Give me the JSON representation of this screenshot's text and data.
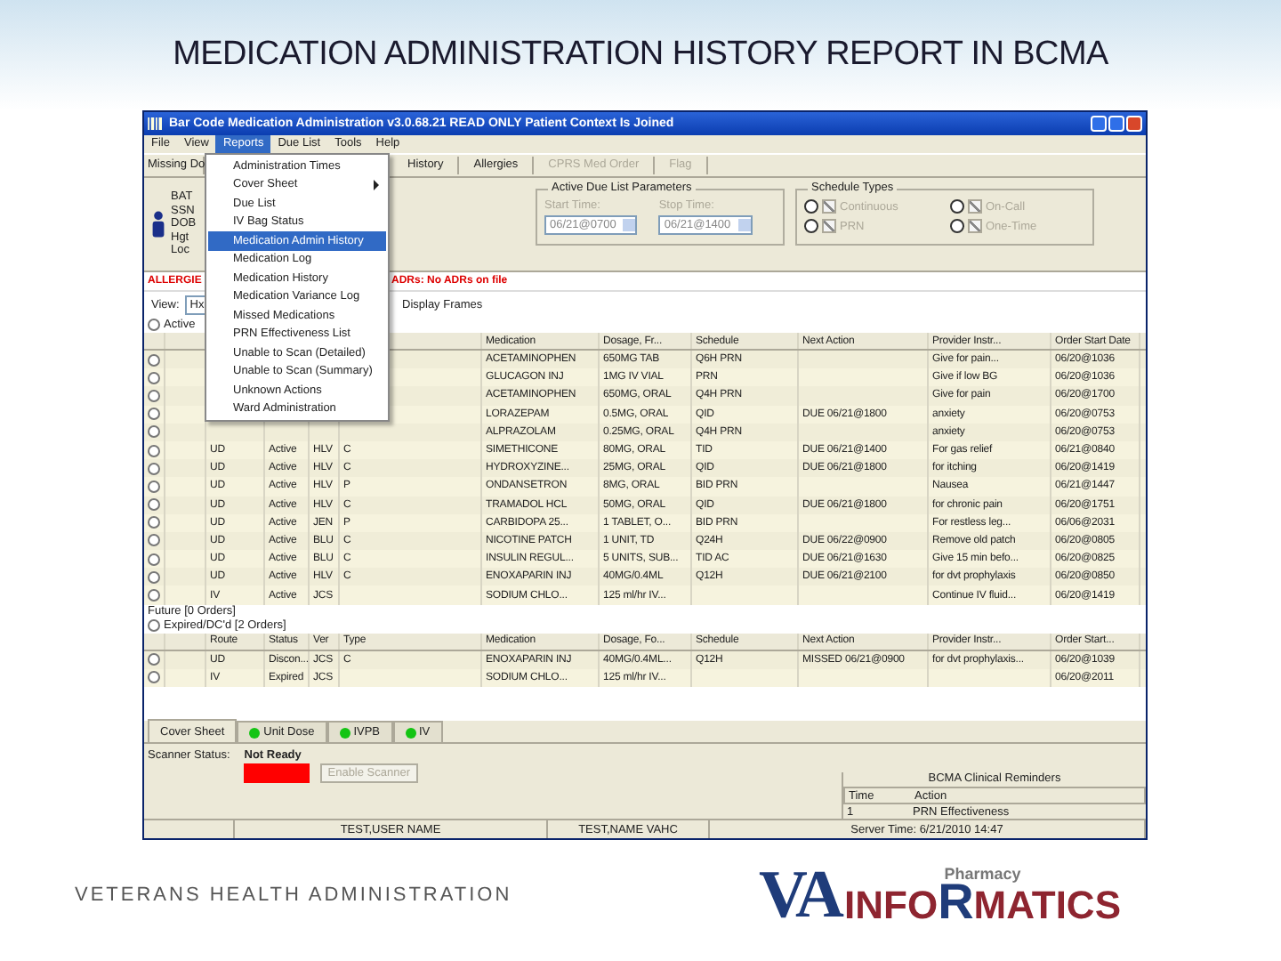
{
  "slide_title": "MEDICATION ADMINISTRATION HISTORY REPORT IN BCMA",
  "window": {
    "title": "Bar Code Medication Administration  v3.0.68.21   READ ONLY   Patient Context Is Joined"
  },
  "menu": [
    {
      "label": "File",
      "selected": false
    },
    {
      "label": "View",
      "selected": false
    },
    {
      "label": "Reports",
      "selected": true
    },
    {
      "label": "Due List",
      "selected": false
    },
    {
      "label": "Tools",
      "selected": false
    },
    {
      "label": "Help",
      "selected": false
    }
  ],
  "toolbar": [
    {
      "label": "Missing Do",
      "disabled": false
    },
    {
      "label": "History",
      "disabled": false
    },
    {
      "label": "Allergies",
      "disabled": false
    },
    {
      "label": "CPRS Med Order",
      "disabled": true
    },
    {
      "label": "Flag",
      "disabled": true
    }
  ],
  "patient_lines": [
    "BAT",
    "SSN",
    "DOB",
    "Hgt",
    "Loc"
  ],
  "due_list": {
    "title": "Active Due List Parameters",
    "start_label": "Start Time:",
    "start_value": "06/21@0700",
    "stop_label": "Stop Time:",
    "stop_value": "06/21@1400"
  },
  "schedule_types": {
    "title": "Schedule Types",
    "items": [
      {
        "label": "Continuous",
        "checked": true,
        "selected": false
      },
      {
        "label": "On-Call",
        "checked": true,
        "selected": false
      },
      {
        "label": "PRN",
        "checked": true,
        "selected": false
      },
      {
        "label": "One-Time",
        "checked": true,
        "selected": false
      }
    ]
  },
  "allergy_line": {
    "allergies": "ALLERGIE",
    "adrs": "ADRs: No ADRs on file"
  },
  "view": {
    "label": "View:",
    "value": "Hx",
    "frames": "Display Frames"
  },
  "active_label": "Active",
  "reports_menu": [
    {
      "label": "Administration Times",
      "submenu": false,
      "selected": false
    },
    {
      "label": "Cover Sheet",
      "submenu": true,
      "selected": false
    },
    {
      "label": "Due List",
      "submenu": false,
      "selected": false
    },
    {
      "label": "IV Bag Status",
      "submenu": false,
      "selected": false
    },
    {
      "label": "Medication Admin History",
      "submenu": false,
      "selected": true
    },
    {
      "label": "Medication Log",
      "submenu": false,
      "selected": false
    },
    {
      "label": "Medication History",
      "submenu": false,
      "selected": false
    },
    {
      "label": "Medication Variance Log",
      "submenu": false,
      "selected": false
    },
    {
      "label": "Missed Medications",
      "submenu": false,
      "selected": false
    },
    {
      "label": "PRN Effectiveness List",
      "submenu": false,
      "selected": false
    },
    {
      "label": "Unable to Scan (Detailed)",
      "submenu": false,
      "selected": false
    },
    {
      "label": "Unable to Scan (Summary)",
      "submenu": false,
      "selected": false
    },
    {
      "label": "Unknown Actions",
      "submenu": false,
      "selected": false
    },
    {
      "label": "Ward Administration",
      "submenu": false,
      "selected": false
    }
  ],
  "table": {
    "columns": [
      "Medication",
      "Dosage, Fr...",
      "Schedule",
      "Next Action",
      "Provider Instr...",
      "Order Start Date"
    ],
    "rows": [
      {
        "med": "ACETAMINOPHEN",
        "dose": "650MG TAB",
        "sched": "Q6H PRN",
        "next": "",
        "prov": "Give for pain...",
        "start": "06/20@1036"
      },
      {
        "med": "GLUCAGON INJ",
        "dose": "1MG IV VIAL",
        "sched": "PRN",
        "next": "",
        "prov": "Give if low BG",
        "start": "06/20@1036"
      },
      {
        "med": "ACETAMINOPHEN",
        "dose": "650MG, ORAL",
        "sched": "Q4H PRN",
        "next": "",
        "prov": "Give for pain",
        "start": "06/20@1700"
      },
      {
        "med": "LORAZEPAM",
        "dose": "0.5MG, ORAL",
        "sched": "QID",
        "next": "DUE 06/21@1800",
        "prov": "anxiety",
        "start": "06/20@0753"
      },
      {
        "med": "ALPRAZOLAM",
        "dose": "0.25MG, ORAL",
        "sched": "Q4H PRN",
        "next": "",
        "prov": "anxiety",
        "start": "06/20@0753"
      },
      {
        "route": "UD",
        "status": "Active",
        "ver": "HLV",
        "type": "C",
        "med": "SIMETHICONE",
        "dose": "80MG, ORAL",
        "sched": "TID",
        "next": "DUE 06/21@1400",
        "prov": "For gas relief",
        "start": "06/21@0840"
      },
      {
        "route": "UD",
        "status": "Active",
        "ver": "HLV",
        "type": "C",
        "med": "HYDROXYZINE...",
        "dose": "25MG, ORAL",
        "sched": "QID",
        "next": "DUE 06/21@1800",
        "prov": "for itching",
        "start": "06/20@1419"
      },
      {
        "route": "UD",
        "status": "Active",
        "ver": "HLV",
        "type": "P",
        "med": "ONDANSETRON",
        "dose": "8MG, ORAL",
        "sched": "BID PRN",
        "next": "",
        "prov": "Nausea",
        "start": "06/21@1447"
      },
      {
        "route": "UD",
        "status": "Active",
        "ver": "HLV",
        "type": "C",
        "med": "TRAMADOL HCL",
        "dose": "50MG, ORAL",
        "sched": "QID",
        "next": "DUE 06/21@1800",
        "prov": "for chronic pain",
        "start": "06/20@1751"
      },
      {
        "route": "UD",
        "status": "Active",
        "ver": "JEN",
        "type": "P",
        "med": "CARBIDOPA 25...",
        "dose": "1 TABLET, O...",
        "sched": "BID PRN",
        "next": "",
        "prov": "For restless leg...",
        "start": "06/06@2031"
      },
      {
        "route": "UD",
        "status": "Active",
        "ver": "BLU",
        "type": "C",
        "med": "NICOTINE PATCH",
        "dose": "1 UNIT, TD",
        "sched": "Q24H",
        "next": "DUE 06/22@0900",
        "prov": "Remove old patch",
        "start": "06/20@0805"
      },
      {
        "route": "UD",
        "status": "Active",
        "ver": "BLU",
        "type": "C",
        "med": "INSULIN REGUL...",
        "dose": "5 UNITS, SUB...",
        "sched": "TID AC",
        "next": "DUE 06/21@1630",
        "prov": "Give 15 min befo...",
        "start": "06/20@0825"
      },
      {
        "route": "UD",
        "status": "Active",
        "ver": "HLV",
        "type": "C",
        "med": "ENOXAPARIN INJ",
        "dose": "40MG/0.4ML",
        "sched": "Q12H",
        "next": "DUE 06/21@2100",
        "prov": "for dvt prophylaxis",
        "start": "06/20@0850"
      },
      {
        "route": "IV",
        "status": "Active",
        "ver": "JCS",
        "type": "",
        "med": "SODIUM CHLO...",
        "dose": "125 ml/hr IV...",
        "sched": "",
        "next": "",
        "prov": "Continue IV fluid...",
        "start": "06/20@1419"
      }
    ]
  },
  "future_label": "Future [0 Orders]",
  "expired_label": "Expired/DC'd [2 Orders]",
  "expired_table": {
    "columns": [
      "Route",
      "Status",
      "Ver",
      "Type",
      "Medication",
      "Dosage, Fo...",
      "Schedule",
      "Next Action",
      "Provider Instr...",
      "Order Start..."
    ],
    "rows": [
      {
        "route": "UD",
        "status": "Discon...",
        "ver": "JCS",
        "type": "C",
        "med": "ENOXAPARIN INJ",
        "dose": "40MG/0.4ML...",
        "sched": "Q12H",
        "next": "MISSED 06/21@0900",
        "prov": "for dvt prophylaxis...",
        "start": "06/20@1039"
      },
      {
        "route": "IV",
        "status": "Expired",
        "ver": "JCS",
        "type": "",
        "med": "SODIUM CHLO...",
        "dose": "125 ml/hr IV...",
        "sched": "",
        "next": "",
        "prov": "",
        "start": "06/20@2011"
      }
    ]
  },
  "tabs": [
    {
      "label": "Cover Sheet",
      "selected": true,
      "dot": false
    },
    {
      "label": "Unit Dose",
      "selected": false,
      "dot": true
    },
    {
      "label": "IVPB",
      "selected": false,
      "dot": true
    },
    {
      "label": "IV",
      "selected": false,
      "dot": true
    }
  ],
  "scanner": {
    "label": "Scanner Status:",
    "state": "Not Ready",
    "ready": false,
    "button": "Enable Scanner"
  },
  "reminders": {
    "title": "BCMA Clinical Reminders",
    "columns": [
      "Time",
      "Action"
    ],
    "rows": [
      {
        "time": "1",
        "action": "PRN Effectiveness"
      }
    ]
  },
  "status_bar": [
    "TEST,USER NAME",
    "TEST,NAME VAHC",
    "Server Time: 6/21/2010 14:47"
  ],
  "footer": "VETERANS HEALTH ADMINISTRATION",
  "logo": {
    "va": "VA",
    "pharmacy": "Pharmacy",
    "info": "INFO",
    "rx": "R",
    "matics": "MATICS"
  }
}
